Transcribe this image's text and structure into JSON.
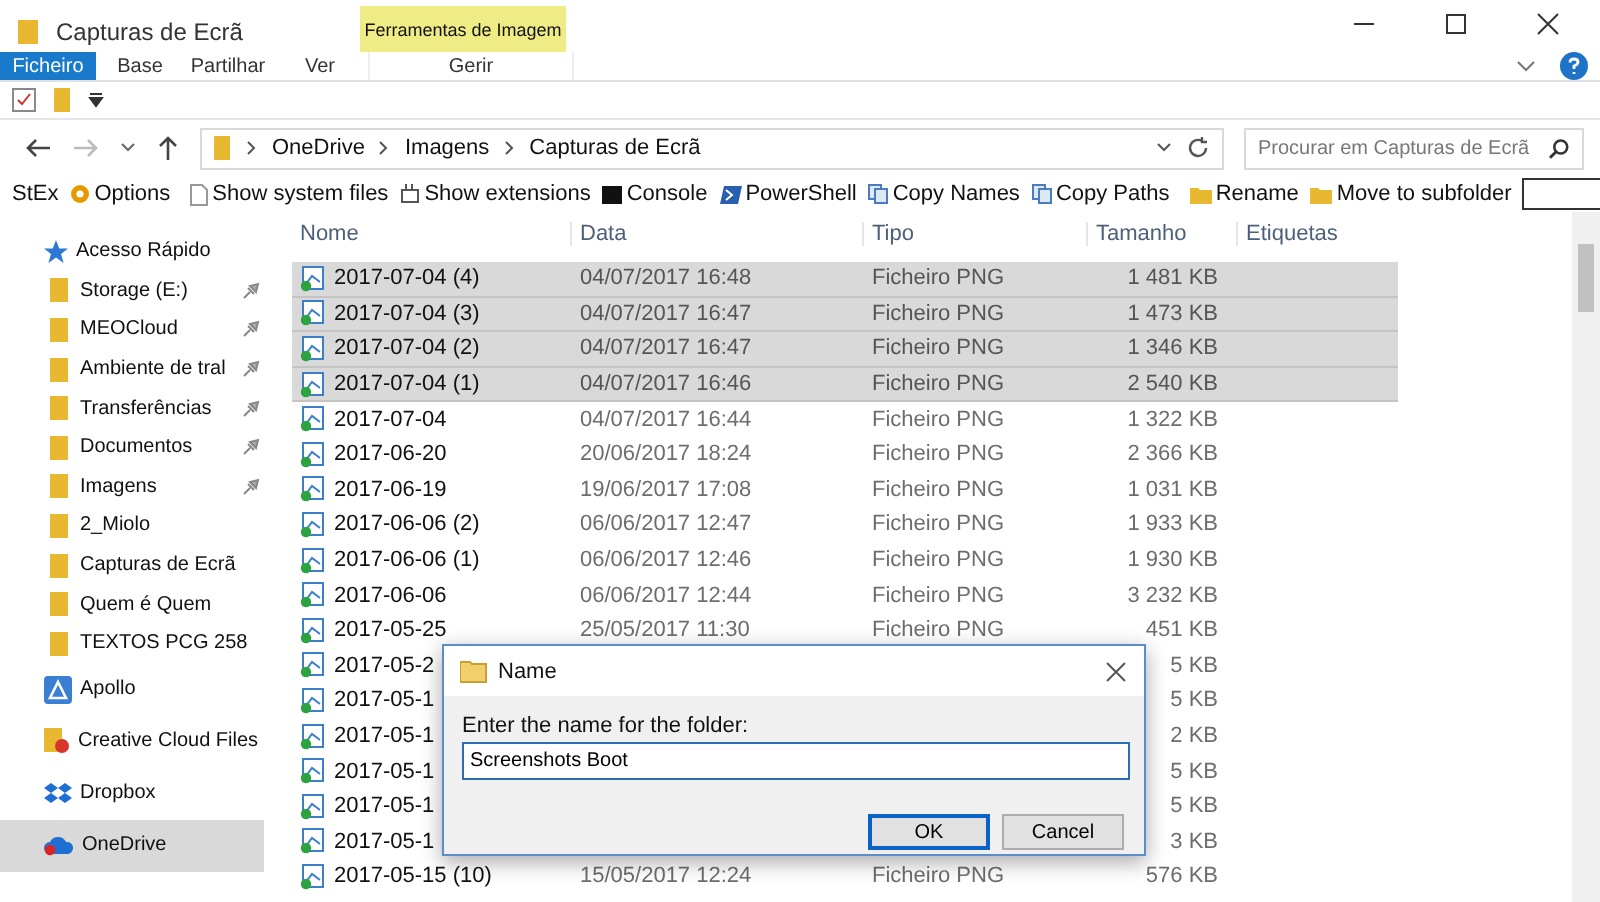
{
  "window": {
    "title": "Capturas de Ecrã"
  },
  "ribbon": {
    "context_group": "Ferramentas de Imagem",
    "tabs": [
      {
        "label": "Ficheiro",
        "selected": true
      },
      {
        "label": "Base",
        "selected": false
      },
      {
        "label": "Partilhar",
        "selected": false
      },
      {
        "label": "Ver",
        "selected": false
      },
      {
        "label": "Gerir",
        "selected": false
      }
    ]
  },
  "address_bar": {
    "crumbs": [
      "OneDrive",
      "Imagens",
      "Capturas de Ecrã"
    ],
    "search_placeholder": "Procurar em Capturas de Ecrã"
  },
  "stex_toolbar": [
    "StEx",
    "Options",
    "Show system files",
    "Show extensions",
    "Console",
    "PowerShell",
    "Copy Names",
    "Copy Paths",
    "Rename",
    "Move to subfolder"
  ],
  "sidebar": [
    {
      "label": "Acesso Rápido",
      "selected": false,
      "children": [
        {
          "label": "Storage (E:)",
          "pinned": true
        },
        {
          "label": "MEOCloud",
          "pinned": true
        },
        {
          "label": "Ambiente de tral",
          "pinned": true
        },
        {
          "label": "Transferências",
          "pinned": true
        },
        {
          "label": "Documentos",
          "pinned": true
        },
        {
          "label": "Imagens",
          "pinned": true
        },
        {
          "label": "2_Miolo",
          "pinned": false
        },
        {
          "label": "Capturas de Ecrã",
          "pinned": false
        },
        {
          "label": "Quem é Quem",
          "pinned": false
        },
        {
          "label": "TEXTOS PCG 258",
          "pinned": false
        }
      ]
    },
    {
      "label": "Apollo",
      "selected": false
    },
    {
      "label": "Creative Cloud Files",
      "selected": false
    },
    {
      "label": "Dropbox",
      "selected": false
    },
    {
      "label": "OneDrive",
      "selected": true
    }
  ],
  "table": {
    "columns": [
      "Nome",
      "Data",
      "Tipo",
      "Tamanho",
      "Etiquetas"
    ],
    "rows": [
      {
        "name": "2017-07-04 (4)",
        "date": "04/07/2017 16:48",
        "type": "Ficheiro PNG",
        "size": "1 481 KB",
        "selected": true
      },
      {
        "name": "2017-07-04 (3)",
        "date": "04/07/2017 16:47",
        "type": "Ficheiro PNG",
        "size": "1 473 KB",
        "selected": true
      },
      {
        "name": "2017-07-04 (2)",
        "date": "04/07/2017 16:47",
        "type": "Ficheiro PNG",
        "size": "1 346 KB",
        "selected": true
      },
      {
        "name": "2017-07-04 (1)",
        "date": "04/07/2017 16:46",
        "type": "Ficheiro PNG",
        "size": "2 540 KB",
        "selected": true
      },
      {
        "name": "2017-07-04",
        "date": "04/07/2017 16:44",
        "type": "Ficheiro PNG",
        "size": "1 322 KB",
        "selected": false
      },
      {
        "name": "2017-06-20",
        "date": "20/06/2017 18:24",
        "type": "Ficheiro PNG",
        "size": "2 366 KB",
        "selected": false
      },
      {
        "name": "2017-06-19",
        "date": "19/06/2017 17:08",
        "type": "Ficheiro PNG",
        "size": "1 031 KB",
        "selected": false
      },
      {
        "name": "2017-06-06 (2)",
        "date": "06/06/2017 12:47",
        "type": "Ficheiro PNG",
        "size": "1 933 KB",
        "selected": false
      },
      {
        "name": "2017-06-06 (1)",
        "date": "06/06/2017 12:46",
        "type": "Ficheiro PNG",
        "size": "1 930 KB",
        "selected": false
      },
      {
        "name": "2017-06-06",
        "date": "06/06/2017 12:44",
        "type": "Ficheiro PNG",
        "size": "3 232 KB",
        "selected": false
      },
      {
        "name": "2017-05-25",
        "date": "25/05/2017 11:30",
        "type": "Ficheiro PNG",
        "size": "451 KB",
        "selected": false
      },
      {
        "name": "2017-05-2",
        "size": "5 KB",
        "selected": false
      },
      {
        "name": "2017-05-1",
        "size": "5 KB",
        "selected": false
      },
      {
        "name": "2017-05-1",
        "size": "2 KB",
        "selected": false
      },
      {
        "name": "2017-05-1",
        "size": "5 KB",
        "selected": false
      },
      {
        "name": "2017-05-1",
        "size": "5 KB",
        "selected": false
      },
      {
        "name": "2017-05-1",
        "size": "3 KB",
        "selected": false
      },
      {
        "name": "2017-05-15 (10)",
        "date": "15/05/2017 12:24",
        "type": "Ficheiro PNG",
        "size": "576 KB",
        "selected": false
      }
    ]
  },
  "dialog": {
    "title": "Name",
    "prompt": "Enter the name for the folder:",
    "value": "Screenshots Boot",
    "buttons": [
      {
        "label": "OK",
        "default": true
      },
      {
        "label": "Cancel",
        "default": false
      }
    ]
  }
}
